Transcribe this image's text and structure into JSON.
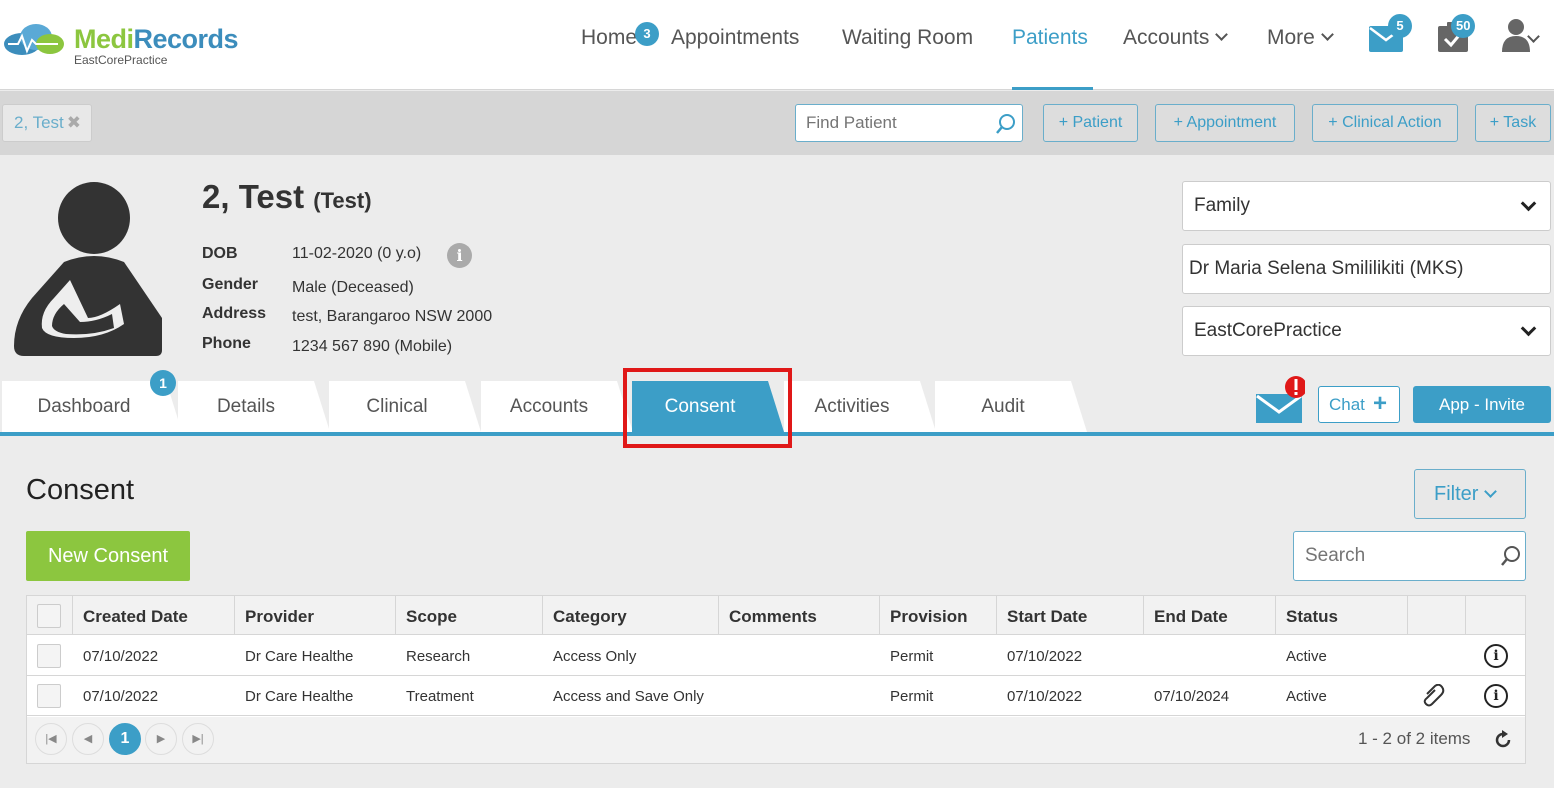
{
  "app": {
    "logo_main_1": "Medi",
    "logo_main_2": "Records",
    "logo_sub": "EastCorePractice"
  },
  "nav": {
    "home": "Home",
    "home_badge": "3",
    "appointments": "Appointments",
    "waiting_room": "Waiting Room",
    "patients": "Patients",
    "accounts": "Accounts",
    "more": "More",
    "messages_badge": "5",
    "tasks_badge": "50"
  },
  "subheader": {
    "open_patient_tab": "2, Test",
    "find_placeholder": "Find Patient",
    "btn_patient": "+ Patient",
    "btn_appointment": "+ Appointment",
    "btn_clinical_action": "+ Clinical Action",
    "btn_task": "+ Task"
  },
  "patient": {
    "name": "2, Test",
    "alias": "(Test)",
    "dob_label": "DOB",
    "dob_value": "11-02-2020 (0 y.o)",
    "gender_label": "Gender",
    "gender_value": "Male (Deceased)",
    "address_label": "Address",
    "address_value": "test, Barangaroo NSW 2000",
    "phone_label": "Phone",
    "phone_value": "1234 567 890 (Mobile)"
  },
  "right_panel": {
    "group_select": "Family",
    "provider": "Dr Maria Selena Smililikiti (MKS)",
    "practice_select": "EastCorePractice"
  },
  "tabs": {
    "dashboard": "Dashboard",
    "dashboard_badge": "1",
    "details": "Details",
    "clinical": "Clinical",
    "accounts": "Accounts",
    "consent": "Consent",
    "activities": "Activities",
    "audit": "Audit",
    "active": "Consent"
  },
  "actions": {
    "chat": "Chat",
    "app_invite": "App - Invite"
  },
  "consent": {
    "title": "Consent",
    "filter": "Filter",
    "new_consent": "New Consent",
    "search_placeholder": "Search",
    "columns": [
      "Created Date",
      "Provider",
      "Scope",
      "Category",
      "Comments",
      "Provision",
      "Start Date",
      "End Date",
      "Status"
    ],
    "rows": [
      {
        "created": "07/10/2022",
        "provider": "Dr Care Healthe",
        "scope": "Research",
        "category": "Access Only",
        "comments": "",
        "provision": "Permit",
        "start": "07/10/2022",
        "end": "",
        "status": "Active",
        "attachment": false
      },
      {
        "created": "07/10/2022",
        "provider": "Dr Care Healthe",
        "scope": "Treatment",
        "category": "Access and Save Only",
        "comments": "",
        "provision": "Permit",
        "start": "07/10/2022",
        "end": "07/10/2024",
        "status": "Active",
        "attachment": true
      }
    ],
    "pager": {
      "current_page": "1",
      "info": "1 - 2 of 2 items"
    }
  },
  "colors": {
    "brand_blue": "#3c9ec7",
    "brand_green": "#8cc63f",
    "highlight_red": "#e01818"
  }
}
